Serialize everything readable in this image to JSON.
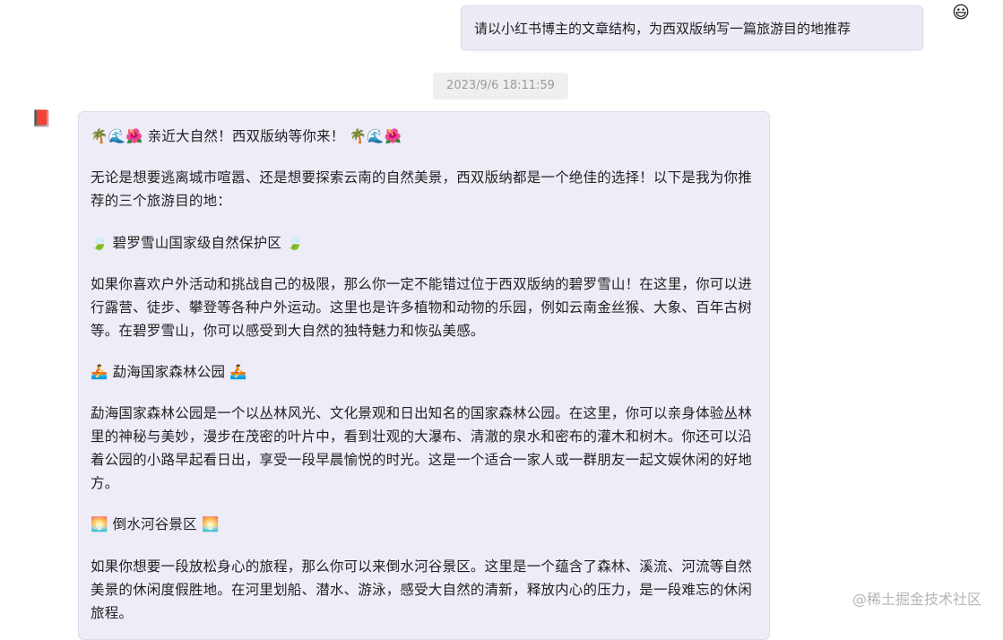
{
  "chat": {
    "user_message": "请以小红书博主的文章结构，为西双版纳写一篇旅游目的地推荐",
    "user_avatar": "😃",
    "timestamp": "2023/9/6 18:11:59",
    "bot_avatar": "📕",
    "bot_message": {
      "title": "🌴🌊🌺 亲近大自然！西双版纳等你来！ 🌴🌊🌺",
      "intro": "无论是想要逃离城市喧嚣、还是想要探索云南的自然美景，西双版纳都是一个绝佳的选择！以下是我为你推荐的三个旅游目的地：",
      "spots": [
        {
          "heading": "🍃 碧罗雪山国家级自然保护区 🍃",
          "description": "如果你喜欢户外活动和挑战自己的极限，那么你一定不能错过位于西双版纳的碧罗雪山！在这里，你可以进行露营、徒步、攀登等各种户外运动。这里也是许多植物和动物的乐园，例如云南金丝猴、大象、百年古树等。在碧罗雪山，你可以感受到大自然的独特魅力和恢弘美感。"
        },
        {
          "heading": "🚣 勐海国家森林公园 🚣",
          "description": "勐海国家森林公园是一个以丛林风光、文化景观和日出知名的国家森林公园。在这里，你可以亲身体验丛林里的神秘与美妙，漫步在茂密的叶片中，看到壮观的大瀑布、清澈的泉水和密布的灌木和树木。你还可以沿着公园的小路早起看日出，享受一段早晨愉悦的时光。这是一个适合一家人或一群朋友一起文娱休闲的好地方。"
        },
        {
          "heading": "🌅 倒水河谷景区 🌅",
          "description": "如果你想要一段放松身心的旅程，那么你可以来倒水河谷景区。这里是一个蕴含了森林、溪流、河流等自然美景的休闲度假胜地。在河里划船、潜水、游泳，感受大自然的清新，释放内心的压力，是一段难忘的休闲旅程。"
        }
      ]
    }
  },
  "watermark": "@稀土掘金技术社区"
}
